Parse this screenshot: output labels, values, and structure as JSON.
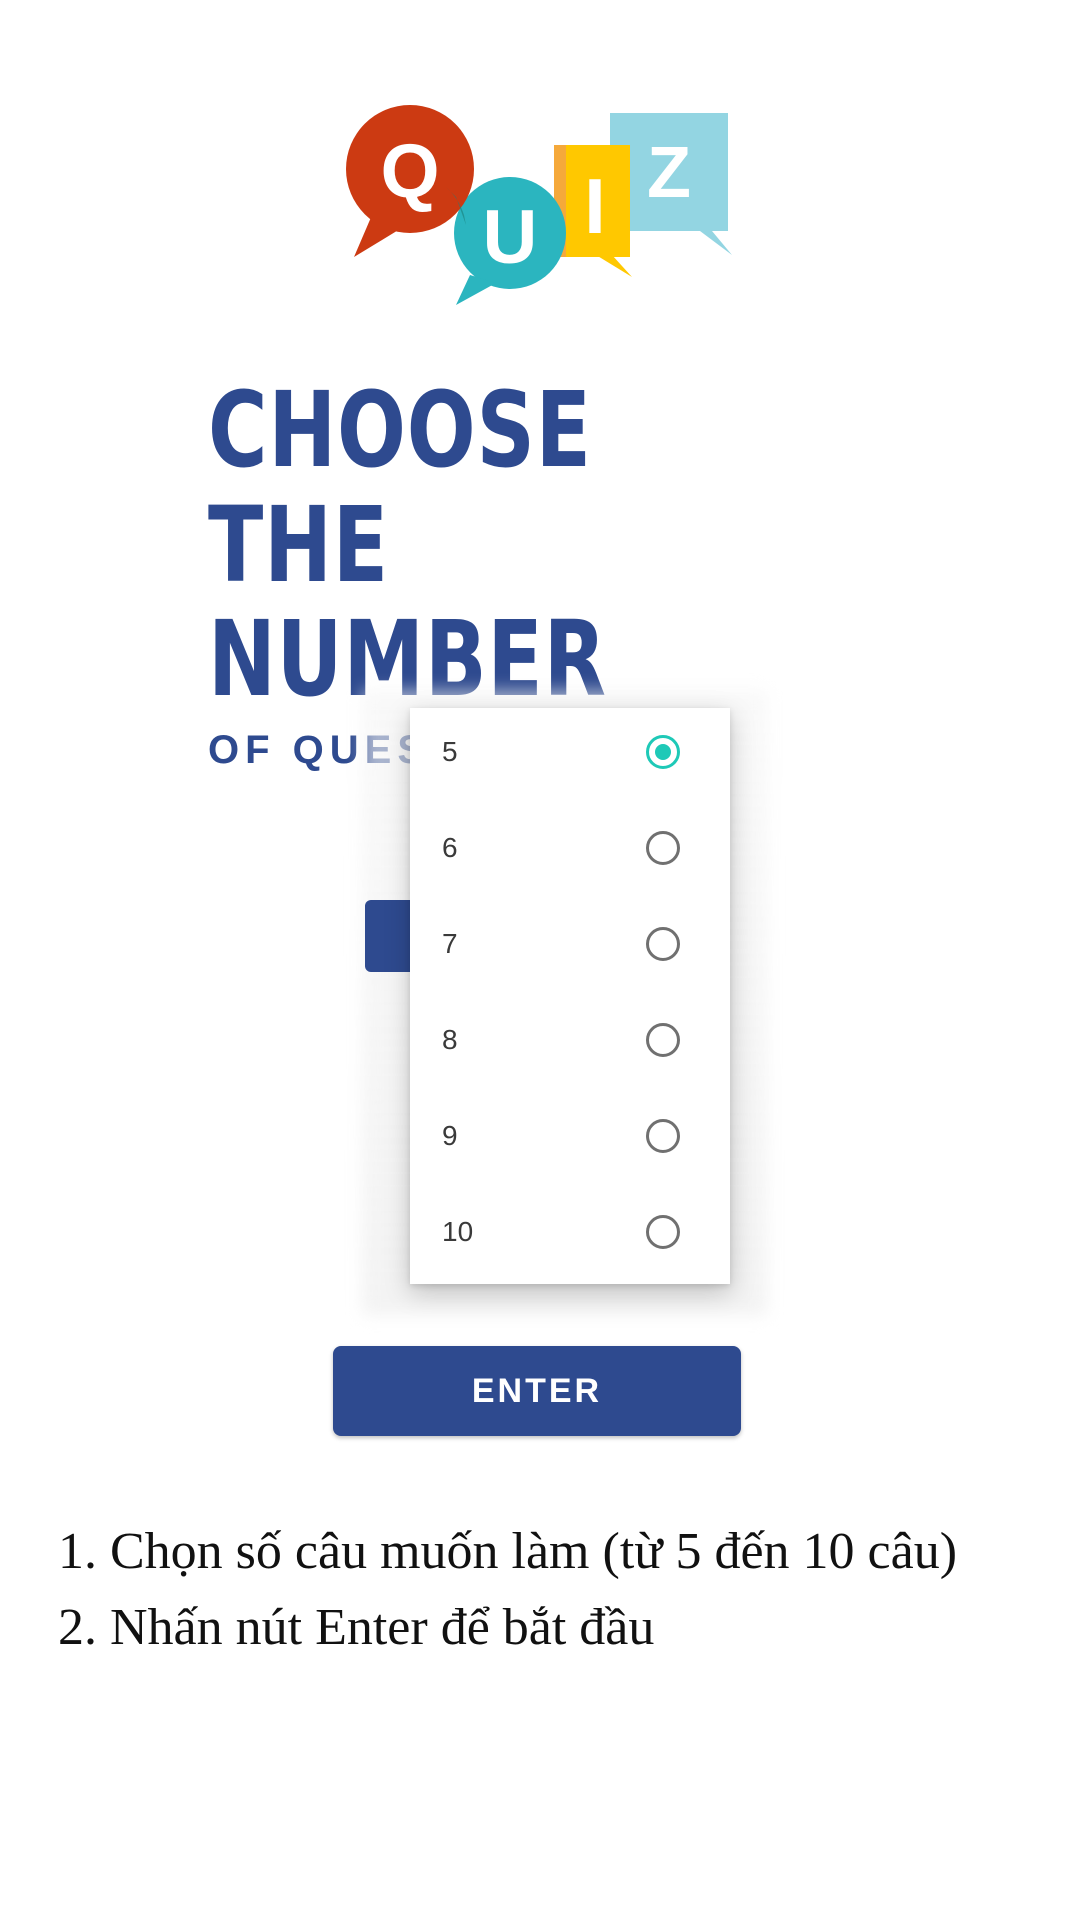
{
  "logo": {
    "letters": [
      "Q",
      "U",
      "I",
      "Z"
    ],
    "colors": {
      "q": "#cc3a12",
      "u": "#2bb5bf",
      "i": "#ffc800",
      "z": "#93d5e2"
    }
  },
  "heading": {
    "line1": "CHOOSE",
    "line2": "THE",
    "line3": "NUMBER",
    "subtitle": "OF QUESTIONS"
  },
  "dropdown": {
    "selected": "5",
    "options": [
      {
        "label": "5",
        "checked": true
      },
      {
        "label": "6",
        "checked": false
      },
      {
        "label": "7",
        "checked": false
      },
      {
        "label": "8",
        "checked": false
      },
      {
        "label": "9",
        "checked": false
      },
      {
        "label": "10",
        "checked": false
      }
    ]
  },
  "enter_button": {
    "label": "ENTER"
  },
  "instructions": [
    "1. Chọn số câu muốn làm (từ 5 đến 10 câu)",
    "2. Nhấn nút Enter để bắt đầu"
  ],
  "colors": {
    "primary": "#2e4a8f",
    "accent": "#1ec9b7"
  }
}
